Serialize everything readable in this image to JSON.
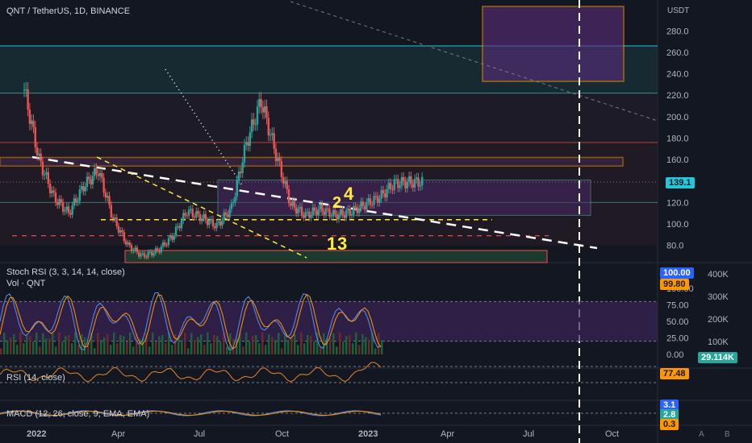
{
  "header": {
    "symbol": "QNT / TetherUS, 1D, BINANCE",
    "currency": "USDT",
    "stoch_label": "Stoch RSI (3, 3, 14, 14, close)",
    "vol_label": "Vol · QNT",
    "rsi_label": "RSI (14, close)",
    "macd_label": "MACD (12, 26, close, 9, EMA, EMA)"
  },
  "colors": {
    "background": "#131722",
    "candle_up": "#26a69a",
    "candle_down": "#ef5350",
    "orange": "#ff9800",
    "purple_zone": "#4a2a66",
    "yellow": "#ffeb3b",
    "teal_line": "#26c6da"
  },
  "tags": {
    "price_last": "139.1",
    "stoch_k": "100.00",
    "stoch_d": "99.80",
    "volume": "29.114K",
    "rsi": "77.48",
    "macd_a": "3.1",
    "macd_b": "2.8",
    "macd_c": "0.3"
  },
  "annotations": {
    "wave_2": "2",
    "wave_4": "4",
    "wave_1": "1",
    "wave_3": "3"
  },
  "footer": {
    "btn_a": "A",
    "btn_b": "B"
  },
  "chart_data": {
    "type": "candlestick",
    "title": "QNT / TetherUS, 1D, BINANCE",
    "ylabel": "USDT",
    "ylim": [
      65,
      300
    ],
    "price_ticks": [
      "280.0",
      "260.0",
      "240.0",
      "220.0",
      "200.0",
      "180.0",
      "160.0",
      "140.0",
      "120.0",
      "100.0",
      "80.0"
    ],
    "x_ticks": [
      "2022",
      "Apr",
      "Jul",
      "Oct",
      "2023",
      "Apr",
      "Jul",
      "Oct"
    ],
    "price_series": {
      "name": "QNT/USDT",
      "x_months": [
        0,
        0.5,
        1,
        1.5,
        2,
        2.5,
        3,
        3.5,
        4,
        4.5,
        5,
        5.5,
        6,
        6.5,
        7,
        7.5,
        8,
        8.5,
        9,
        9.5,
        10,
        10.5,
        11,
        11.5,
        12,
        12.5,
        13,
        13.5
      ],
      "close": [
        225,
        160,
        125,
        110,
        135,
        150,
        105,
        80,
        70,
        75,
        88,
        112,
        106,
        98,
        115,
        175,
        215,
        165,
        118,
        108,
        114,
        108,
        111,
        118,
        125,
        138,
        139,
        139
      ]
    },
    "levels": [
      {
        "name": "upper-cyan",
        "value": 266
      },
      {
        "name": "cyan-2",
        "value": 222
      },
      {
        "name": "red-1",
        "value": 176
      },
      {
        "name": "orange-box",
        "value_low": 154,
        "value_high": 162
      },
      {
        "name": "purple-box",
        "value_low": 108,
        "value_high": 141
      },
      {
        "name": "yellow-dash",
        "value": 104
      },
      {
        "name": "red-dash",
        "value": 89
      }
    ],
    "stoch_rsi": {
      "ticks": [
        "100.00",
        "75.00",
        "50.00",
        "25.00",
        "0.00"
      ],
      "k": 100.0,
      "d": 99.8
    },
    "volume": {
      "ticks": [
        "400K",
        "300K",
        "200K",
        "100K"
      ],
      "last": "29.114K"
    },
    "rsi": {
      "ticks": [
        "50.00"
      ],
      "last": 77.48
    },
    "macd": {
      "values": [
        3.1,
        2.8,
        0.3
      ]
    }
  }
}
